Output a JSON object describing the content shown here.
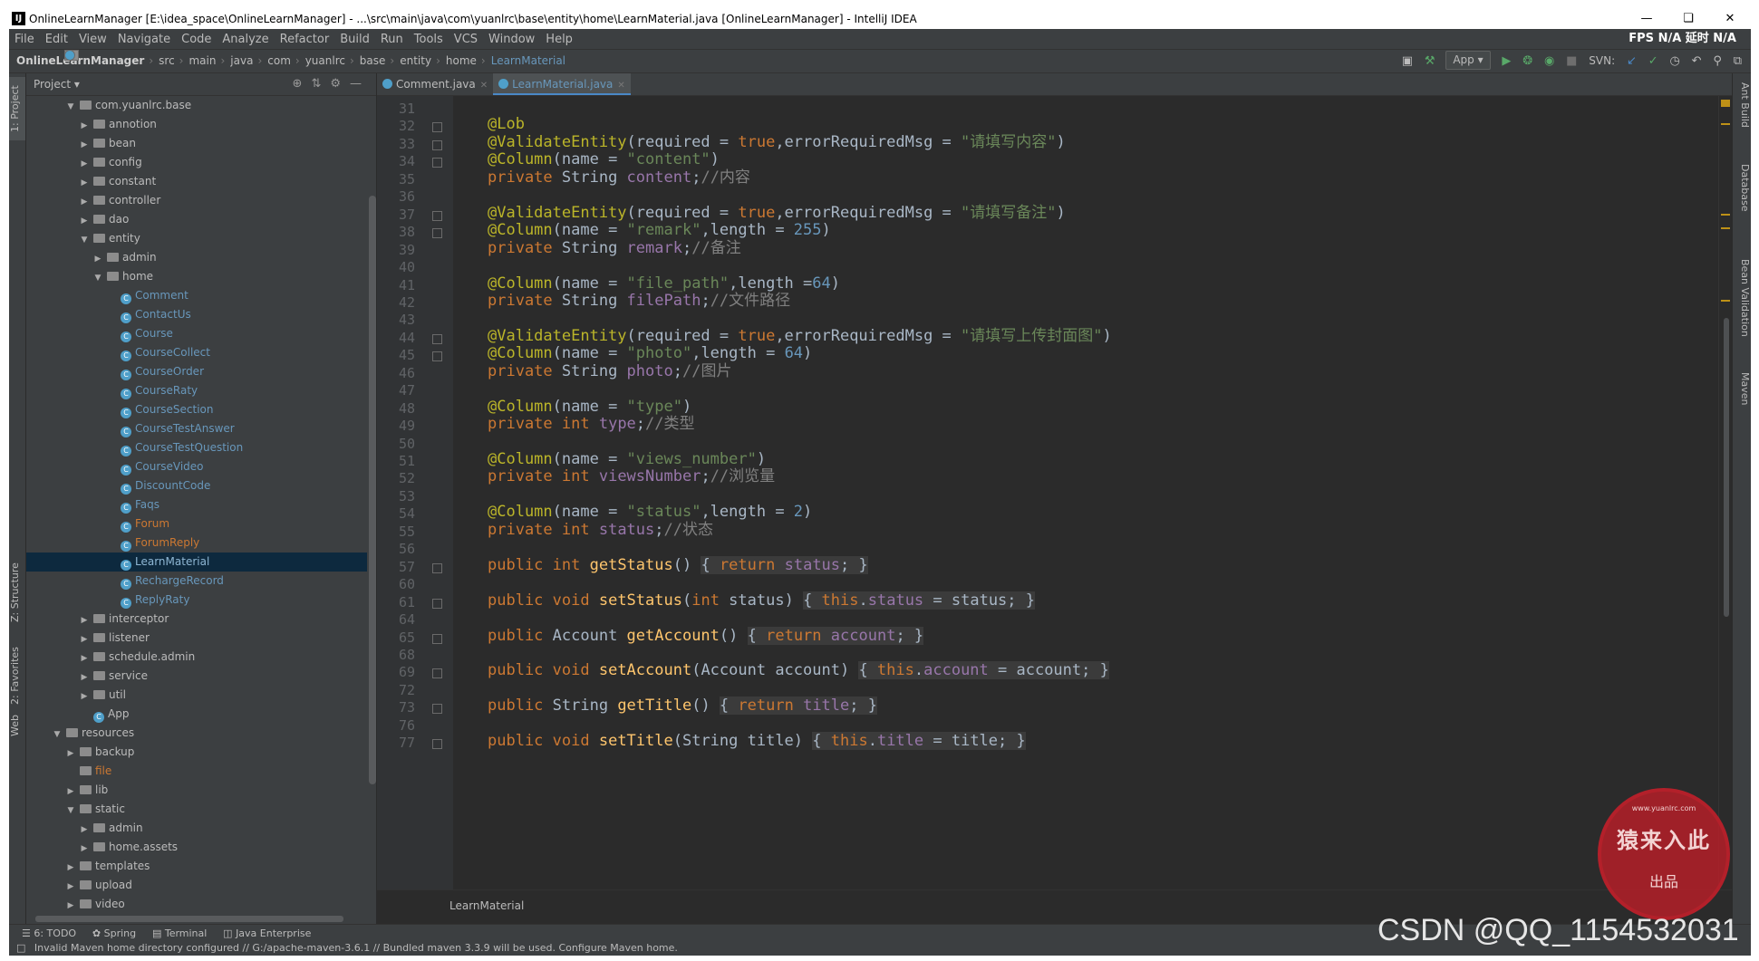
{
  "window": {
    "title": "OnlineLearnManager [E:\\idea_space\\OnlineLearnManager] - ...\\src\\main\\java\\com\\yuanlrc\\base\\entity\\home\\LearnMaterial.java [OnlineLearnManager] - IntelliJ IDEA",
    "app_icon": "IJ"
  },
  "menu": {
    "items": [
      "File",
      "Edit",
      "View",
      "Navigate",
      "Code",
      "Analyze",
      "Refactor",
      "Build",
      "Run",
      "Tools",
      "VCS",
      "Window",
      "Help"
    ],
    "right": "FPS  N/A  延时  N/A"
  },
  "nav": {
    "crumbs": [
      "OnlineLearnManager",
      "src",
      "main",
      "java",
      "com",
      "yuanlrc",
      "base",
      "entity",
      "home",
      "LearnMaterial"
    ],
    "run_config": "App ▾",
    "svn": "SVN:"
  },
  "left_tabs": [
    "1: Project",
    "Z: Structure",
    "2: Favorites",
    "Web"
  ],
  "right_tabs": [
    "Ant Build",
    "Database",
    "Bean Validation",
    "Maven"
  ],
  "project": {
    "header": "Project ▾",
    "tree": [
      {
        "depth": 3,
        "arrow": "▼",
        "icon": "folder",
        "label": "com.yuanlrc.base"
      },
      {
        "depth": 4,
        "arrow": "▶",
        "icon": "folder",
        "label": "annotion"
      },
      {
        "depth": 4,
        "arrow": "▶",
        "icon": "folder",
        "label": "bean"
      },
      {
        "depth": 4,
        "arrow": "▶",
        "icon": "folder",
        "label": "config"
      },
      {
        "depth": 4,
        "arrow": "▶",
        "icon": "folder",
        "label": "constant"
      },
      {
        "depth": 4,
        "arrow": "▶",
        "icon": "folder",
        "label": "controller"
      },
      {
        "depth": 4,
        "arrow": "▶",
        "icon": "folder",
        "label": "dao"
      },
      {
        "depth": 4,
        "arrow": "▼",
        "icon": "folder",
        "label": "entity"
      },
      {
        "depth": 5,
        "arrow": "▶",
        "icon": "folder",
        "label": "admin"
      },
      {
        "depth": 5,
        "arrow": "▼",
        "icon": "folder",
        "label": "home"
      },
      {
        "depth": 6,
        "arrow": "",
        "icon": "class",
        "label": "Comment",
        "style": "cls"
      },
      {
        "depth": 6,
        "arrow": "",
        "icon": "class",
        "label": "ContactUs",
        "style": "cls"
      },
      {
        "depth": 6,
        "arrow": "",
        "icon": "class",
        "label": "Course",
        "style": "cls"
      },
      {
        "depth": 6,
        "arrow": "",
        "icon": "class",
        "label": "CourseCollect",
        "style": "cls"
      },
      {
        "depth": 6,
        "arrow": "",
        "icon": "class",
        "label": "CourseOrder",
        "style": "cls"
      },
      {
        "depth": 6,
        "arrow": "",
        "icon": "class",
        "label": "CourseRaty",
        "style": "cls"
      },
      {
        "depth": 6,
        "arrow": "",
        "icon": "class",
        "label": "CourseSection",
        "style": "cls"
      },
      {
        "depth": 6,
        "arrow": "",
        "icon": "class",
        "label": "CourseTestAnswer",
        "style": "cls"
      },
      {
        "depth": 6,
        "arrow": "",
        "icon": "class",
        "label": "CourseTestQuestion",
        "style": "cls"
      },
      {
        "depth": 6,
        "arrow": "",
        "icon": "class",
        "label": "CourseVideo",
        "style": "cls"
      },
      {
        "depth": 6,
        "arrow": "",
        "icon": "class",
        "label": "DiscountCode",
        "style": "cls"
      },
      {
        "depth": 6,
        "arrow": "",
        "icon": "class",
        "label": "Faqs",
        "style": "cls"
      },
      {
        "depth": 6,
        "arrow": "",
        "icon": "class",
        "label": "Forum",
        "style": "red"
      },
      {
        "depth": 6,
        "arrow": "",
        "icon": "class",
        "label": "ForumReply",
        "style": "red"
      },
      {
        "depth": 6,
        "arrow": "",
        "icon": "class",
        "label": "LearnMaterial",
        "style": "cls",
        "selected": true
      },
      {
        "depth": 6,
        "arrow": "",
        "icon": "class",
        "label": "RechargeRecord",
        "style": "cls"
      },
      {
        "depth": 6,
        "arrow": "",
        "icon": "class",
        "label": "ReplyRaty",
        "style": "cls"
      },
      {
        "depth": 4,
        "arrow": "▶",
        "icon": "folder",
        "label": "interceptor"
      },
      {
        "depth": 4,
        "arrow": "▶",
        "icon": "folder",
        "label": "listener"
      },
      {
        "depth": 4,
        "arrow": "▶",
        "icon": "folder",
        "label": "schedule.admin"
      },
      {
        "depth": 4,
        "arrow": "▶",
        "icon": "folder",
        "label": "service"
      },
      {
        "depth": 4,
        "arrow": "▶",
        "icon": "folder",
        "label": "util"
      },
      {
        "depth": 4,
        "arrow": "",
        "icon": "class",
        "label": "App"
      },
      {
        "depth": 2,
        "arrow": "▼",
        "icon": "folder",
        "label": "resources"
      },
      {
        "depth": 3,
        "arrow": "▶",
        "icon": "folder",
        "label": "backup"
      },
      {
        "depth": 3,
        "arrow": "",
        "icon": "folder",
        "label": "file",
        "style": "red"
      },
      {
        "depth": 3,
        "arrow": "▶",
        "icon": "folder",
        "label": "lib"
      },
      {
        "depth": 3,
        "arrow": "▼",
        "icon": "folder",
        "label": "static"
      },
      {
        "depth": 4,
        "arrow": "▶",
        "icon": "folder",
        "label": "admin"
      },
      {
        "depth": 4,
        "arrow": "▶",
        "icon": "folder",
        "label": "home.assets"
      },
      {
        "depth": 3,
        "arrow": "▶",
        "icon": "folder",
        "label": "templates"
      },
      {
        "depth": 3,
        "arrow": "▶",
        "icon": "folder",
        "label": "upload"
      },
      {
        "depth": 3,
        "arrow": "▶",
        "icon": "folder",
        "label": "video"
      }
    ]
  },
  "editor": {
    "tabs": [
      {
        "label": "Comment.java",
        "active": false
      },
      {
        "label": "LearnMaterial.java",
        "active": true
      }
    ],
    "breadcrumb": "LearnMaterial",
    "lines": [
      {
        "no": "31",
        "html": ""
      },
      {
        "no": "32",
        "html": "<span class='a'>@Lob</span>"
      },
      {
        "no": "33",
        "html": "<span class='a'>@ValidateEntity</span>(required = <span class='k'>true</span>,errorRequiredMsg = <span class='s'>\"请填写内容\"</span>)"
      },
      {
        "no": "34",
        "html": "<span class='a'>@Column</span>(name = <span class='s'>\"content\"</span>)"
      },
      {
        "no": "35",
        "html": "<span class='k'>private</span> String <span class='f'>content</span>;<span class='c'>//内容</span>"
      },
      {
        "no": "36",
        "html": ""
      },
      {
        "no": "37",
        "html": "<span class='a'>@ValidateEntity</span>(required = <span class='k'>true</span>,errorRequiredMsg = <span class='s'>\"请填写备注\"</span>)"
      },
      {
        "no": "38",
        "html": "<span class='a'>@Column</span>(name = <span class='s'>\"remark\"</span>,length = <span class='n'>255</span>)"
      },
      {
        "no": "39",
        "html": "<span class='k'>private</span> String <span class='f'>remark</span>;<span class='c'>//备注</span>"
      },
      {
        "no": "40",
        "html": ""
      },
      {
        "no": "41",
        "html": "<span class='a'>@Column</span>(name = <span class='s'>\"file_path\"</span>,length =<span class='n'>64</span>)"
      },
      {
        "no": "42",
        "html": "<span class='k'>private</span> String <span class='f'>filePath</span>;<span class='c'>//文件路径</span>"
      },
      {
        "no": "43",
        "html": ""
      },
      {
        "no": "44",
        "html": "<span class='a'>@ValidateEntity</span>(required = <span class='k'>true</span>,errorRequiredMsg = <span class='s'>\"请填写上传封面图\"</span>)"
      },
      {
        "no": "45",
        "html": "<span class='a'>@Column</span>(name = <span class='s'>\"photo\"</span>,length = <span class='n'>64</span>)"
      },
      {
        "no": "46",
        "html": "<span class='k'>private</span> String <span class='f'>photo</span>;<span class='c'>//图片</span>"
      },
      {
        "no": "47",
        "html": ""
      },
      {
        "no": "48",
        "html": "<span class='a'>@Column</span>(name = <span class='s'>\"type\"</span>)"
      },
      {
        "no": "49",
        "html": "<span class='k'>private int</span> <span class='f'>type</span>;<span class='c'>//类型</span>"
      },
      {
        "no": "50",
        "html": ""
      },
      {
        "no": "51",
        "html": "<span class='a'>@Column</span>(name = <span class='s'>\"views_number\"</span>)"
      },
      {
        "no": "52",
        "html": "<span class='k'>private int</span> <span class='f'>viewsNumber</span>;<span class='c'>//浏览量</span>"
      },
      {
        "no": "53",
        "html": ""
      },
      {
        "no": "54",
        "html": "<span class='a'>@Column</span>(name = <span class='s'>\"status\"</span>,length = <span class='n'>2</span>)"
      },
      {
        "no": "55",
        "html": "<span class='k'>private int</span> <span class='f'>status</span>;<span class='c'>//状态</span>"
      },
      {
        "no": "56",
        "html": ""
      },
      {
        "no": "57",
        "html": "<span class='k'>public int</span> <span class='m'>getStatus</span>() <span class='br'>{ <span class='k'>return</span> <span class='f'>status</span>; }</span>"
      },
      {
        "no": "60",
        "html": ""
      },
      {
        "no": "61",
        "html": "<span class='k'>public void</span> <span class='m'>setStatus</span>(<span class='k'>int</span> status) <span class='br'>{ <span class='k'>this</span>.<span class='f'>status</span> = status; }</span>"
      },
      {
        "no": "64",
        "html": ""
      },
      {
        "no": "65",
        "html": "<span class='k'>public</span> Account <span class='m'>getAccount</span>() <span class='br'>{ <span class='k'>return</span> <span class='f'>account</span>; }</span>"
      },
      {
        "no": "68",
        "html": ""
      },
      {
        "no": "69",
        "html": "<span class='k'>public void</span> <span class='m'>setAccount</span>(Account account) <span class='br'>{ <span class='k'>this</span>.<span class='f'>account</span> = account; }</span>"
      },
      {
        "no": "72",
        "html": ""
      },
      {
        "no": "73",
        "html": "<span class='k'>public</span> String <span class='m'>getTitle</span>() <span class='br'>{ <span class='k'>return</span> <span class='f'>title</span>; }</span>"
      },
      {
        "no": "76",
        "html": ""
      },
      {
        "no": "77",
        "html": "<span class='k'>public void</span> <span class='m'>setTitle</span>(String title) <span class='br'>{ <span class='k'>this</span>.<span class='f'>title</span> = title; }</span>"
      }
    ]
  },
  "toolwindows": [
    "6: TODO",
    "Spring",
    "Terminal",
    "Java Enterprise"
  ],
  "status": {
    "message": "Invalid Maven home directory configured // G:/apache-maven-3.6.1 // Bundled maven 3.3.9 will be used.  Configure Maven home."
  },
  "stamp": {
    "top": "www.yuanlrc.com",
    "main": "猿来入此",
    "sub": "出品"
  },
  "watermark": "CSDN @QQ_1154532031",
  "colors": {
    "keyword": "#cc7832",
    "annotation": "#bbb529",
    "string": "#6a8759",
    "number": "#6897bb",
    "field": "#9876aa",
    "comment": "#808080",
    "method": "#ffc66d"
  }
}
